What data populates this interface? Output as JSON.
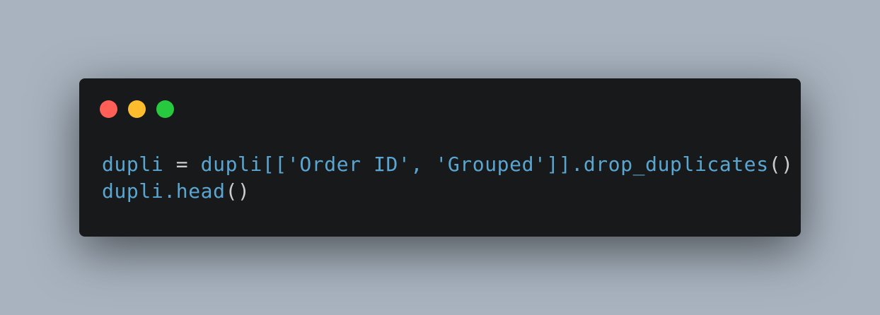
{
  "window": {
    "controls": [
      {
        "name": "close",
        "color": "#ff5f56"
      },
      {
        "name": "minimize",
        "color": "#ffbd2e"
      },
      {
        "name": "zoom",
        "color": "#27c93f"
      }
    ]
  },
  "theme": {
    "background": "#18191b",
    "identifier": "#5aa6d1",
    "operator": "#c9cdd1",
    "paren": "#c9cdd1"
  },
  "code": {
    "line1": {
      "var": "dupli",
      "assign": " = ",
      "expr": "dupli[['Order ID', 'Grouped']].drop_duplicates",
      "call": "()"
    },
    "line2": {
      "expr": "dupli.head",
      "call": "()"
    }
  }
}
